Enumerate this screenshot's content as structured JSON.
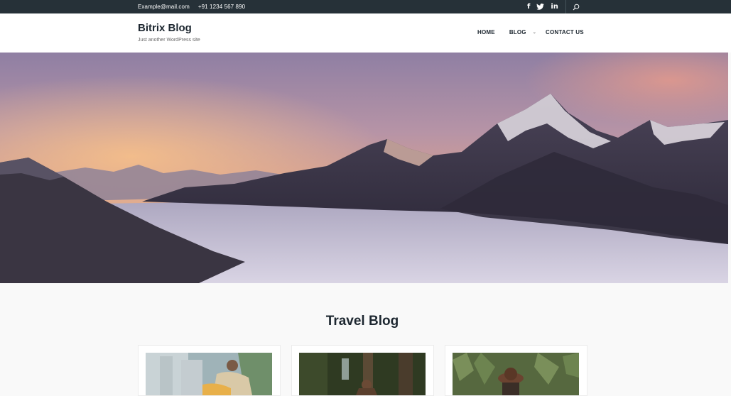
{
  "topbar": {
    "email": "Example@mail.com",
    "phone": "+91 1234 567 890",
    "social": [
      {
        "name": "facebook-icon",
        "glyph": "f"
      },
      {
        "name": "twitter-icon",
        "glyph": ""
      },
      {
        "name": "linkedin-icon",
        "glyph": "in"
      }
    ],
    "search_icon": "search-icon"
  },
  "header": {
    "title": "Bitrix Blog",
    "tagline": "Just another WordPress site"
  },
  "nav": {
    "items": [
      {
        "label": "HOME"
      },
      {
        "label": "BLOG",
        "dropdown_icon": "chevron-down-icon"
      },
      {
        "label": "CONTACT US"
      }
    ]
  },
  "hero": {
    "image": "mountain-sunset-sea-of-clouds"
  },
  "main": {
    "section_title": "Travel Blog",
    "cards": [
      {
        "image": "couple-in-hammock-photo"
      },
      {
        "image": "forest-hiker-photo"
      },
      {
        "image": "cornfield-hat-photo"
      }
    ]
  },
  "colors": {
    "topbar_bg": "#263138",
    "text_dark": "#1d2730",
    "page_bg": "#f9f9f9"
  }
}
